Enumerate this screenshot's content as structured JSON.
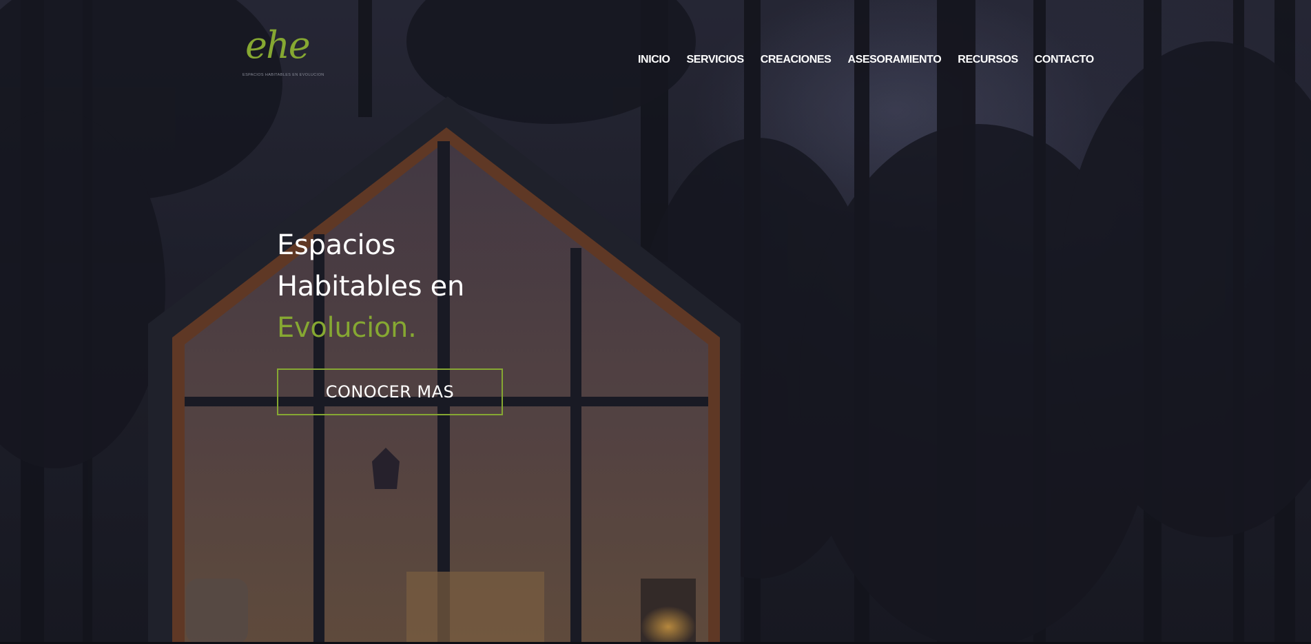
{
  "site": {
    "logo": {
      "script_text": "ehe",
      "tagline": "ESPACIOS HABITABLES EN EVOLUCION"
    },
    "nav": {
      "items": [
        {
          "label": "INICIO"
        },
        {
          "label": "SERVICIOS"
        },
        {
          "label": "CREACIONES"
        },
        {
          "label": "ASESORAMIENTO"
        },
        {
          "label": "RECURSOS"
        },
        {
          "label": "CONTACTO"
        }
      ]
    },
    "hero": {
      "line1": "Espacios",
      "line2": "Habitables en",
      "line3": "Evolucion.",
      "cta_label": "CONOCER MAS",
      "background_description_icon": "forest-cabin-image"
    },
    "colors": {
      "accent": "#86a832",
      "text": "#ffffff",
      "background": "#1c1d27"
    }
  }
}
